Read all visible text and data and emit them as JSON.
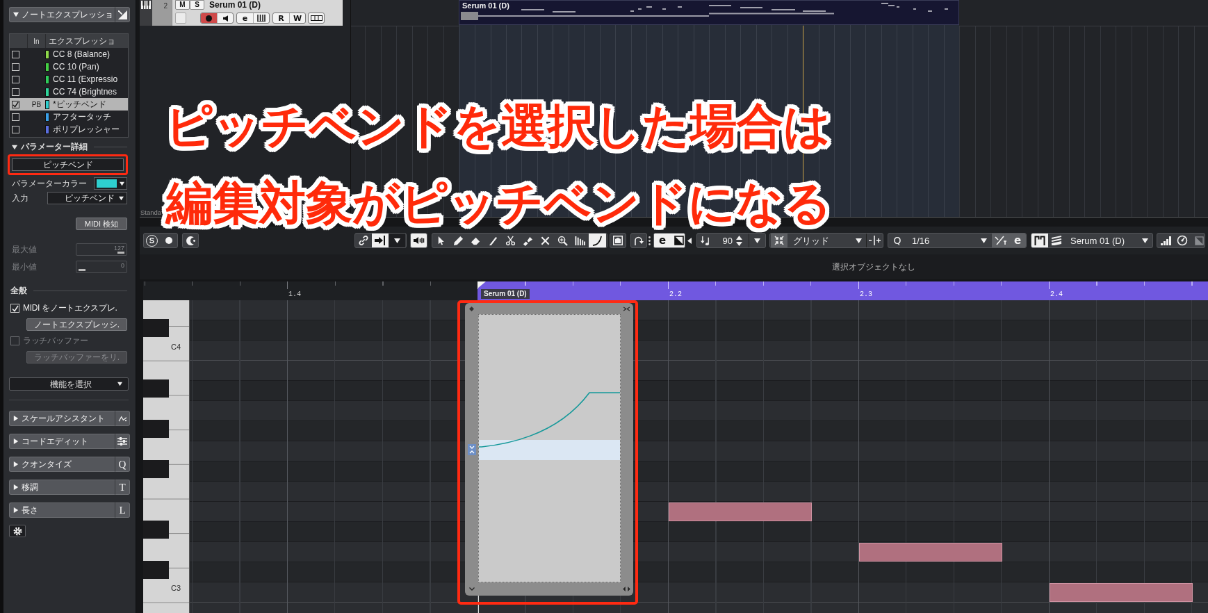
{
  "inspector": {
    "header": {
      "title": "ノートエクスプレッショ",
      "expanded": true
    },
    "expression_table": {
      "columns": [
        "In",
        "エクスプレッショ"
      ],
      "rows": [
        {
          "name": "CC 8 (Balance)",
          "checked": false,
          "selected": false,
          "color": "#8ed84a"
        },
        {
          "name": "CC 10 (Pan)",
          "checked": false,
          "selected": false,
          "color": "#44d044"
        },
        {
          "name": "CC 11 (Expressio",
          "checked": false,
          "selected": false,
          "color": "#2ecc5a"
        },
        {
          "name": "CC 74 (Brightnes",
          "checked": false,
          "selected": false,
          "color": "#2ed49a"
        },
        {
          "in": "PB",
          "name": "*ピッチベンド",
          "checked": true,
          "selected": true,
          "color": "#2ecfcf"
        },
        {
          "name": "アフタータッチ",
          "checked": false,
          "selected": false,
          "color": "#3aa0e8"
        },
        {
          "name": "ポリプレッシャー",
          "checked": false,
          "selected": false,
          "color": "#5a6ee0"
        }
      ]
    },
    "parameter_details": {
      "title": "パラメーター詳細",
      "expanded": true,
      "target_button": "ピッチベンド",
      "color_label": "パラメーターカラー",
      "input_label": "入力",
      "input_value": "ピッチベンド",
      "learn_button": "MIDI 検知",
      "max": {
        "label": "最大値",
        "value": "127",
        "level": 1,
        "disabled": true
      },
      "min": {
        "label": "最小値",
        "value": "0",
        "level": 0,
        "disabled": true
      }
    },
    "general": {
      "title": "全般",
      "options": [
        {
          "kind": "checkbox",
          "label": "MIDI をノートエクスプレ.",
          "checked": true,
          "disabled": false
        },
        {
          "kind": "button",
          "label": "ノートエクスプレッシ.",
          "disabled": false
        },
        {
          "kind": "checkbox",
          "label": "ラッチバッファー",
          "checked": false,
          "disabled": true
        },
        {
          "kind": "button",
          "label": "ラッチバッファーをリ.",
          "disabled": true
        }
      ],
      "function_select": "機能を選択"
    },
    "sections": [
      {
        "kind": "scale",
        "title": "スケールアシスタント",
        "expanded": false
      },
      {
        "kind": "chord",
        "title": "コードエディット",
        "expanded": false
      },
      {
        "kind": "letter",
        "title": "クオンタイズ",
        "letter": "Q",
        "expanded": false
      },
      {
        "kind": "letter",
        "title": "移調",
        "letter": "T",
        "expanded": false
      },
      {
        "kind": "letter",
        "title": "長さ",
        "letter": "L",
        "expanded": false
      }
    ]
  },
  "track": {
    "number": "2",
    "mute_label": "M",
    "solo_label": "S",
    "name": "Serum 01 (D)",
    "record_enabled": true,
    "edit_label": "e",
    "read_label": "R",
    "write_label": "W"
  },
  "arrange": {
    "event_name": "Serum 01 (D)",
    "track_list_footer": "Standa"
  },
  "caption": [
    "ピッチベンドを選択した場合は",
    "編集対象がピッチベンドになる"
  ],
  "toolbar": {
    "solo_label": "S",
    "tools": [
      {
        "kind": "select",
        "selected": false
      },
      {
        "kind": "draw",
        "selected": false
      },
      {
        "kind": "erase",
        "selected": false
      },
      {
        "kind": "trim",
        "selected": false
      },
      {
        "kind": "split",
        "selected": false
      },
      {
        "kind": "glue",
        "selected": false
      },
      {
        "kind": "mute",
        "selected": false
      },
      {
        "kind": "zoom",
        "selected": false
      },
      {
        "kind": "bars",
        "selected": false
      },
      {
        "kind": "line",
        "selected": true
      }
    ],
    "edit_label": "e",
    "velocity": "90",
    "snap_type": "グリッド",
    "quantize_label": "Q",
    "quantize": "1/16",
    "swing_label": "e",
    "editor_target": "Serum 01 (D)"
  },
  "status_message": "選択オブジェクトなし",
  "ruler": {
    "marks": [
      "1.4",
      "2.2",
      "2.3",
      "2.4"
    ],
    "event_name": "Serum 01 (D)"
  },
  "keyboard": {
    "labels": [
      "C4",
      "C3"
    ]
  }
}
